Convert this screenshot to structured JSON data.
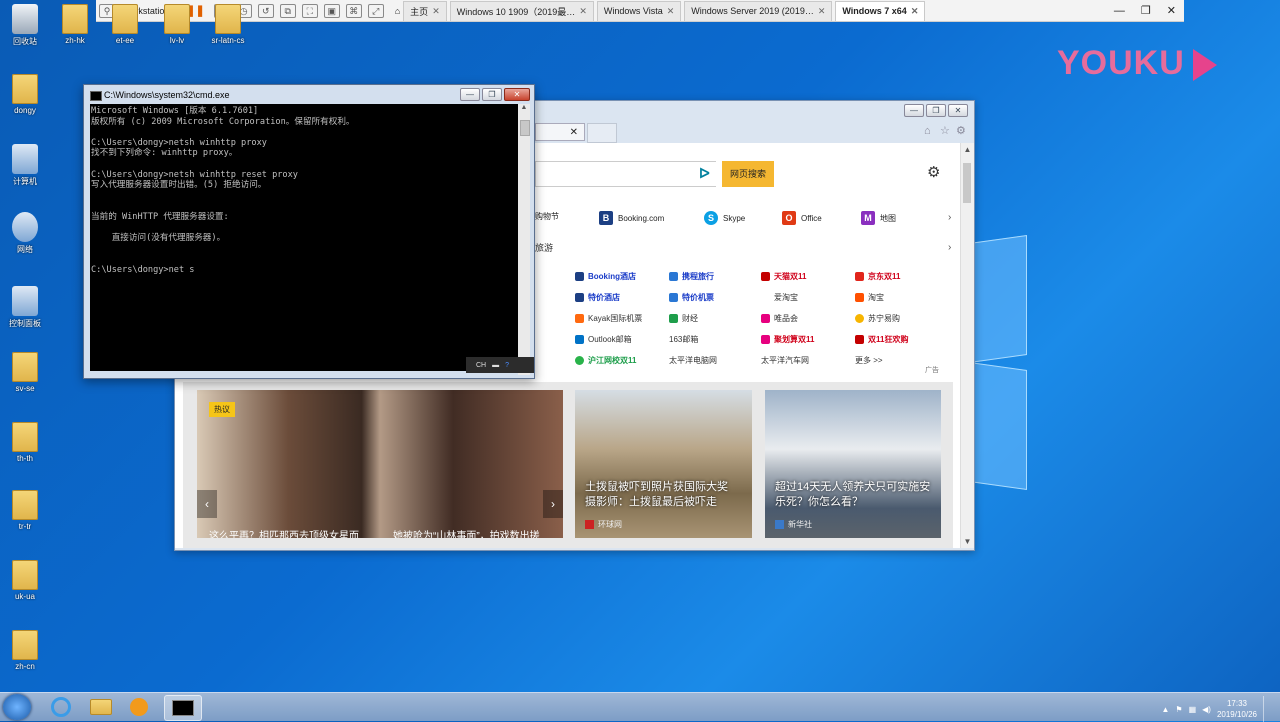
{
  "host_toolbar": {
    "workstation_label": "Workstation",
    "tabs": [
      {
        "label": "主页"
      },
      {
        "label": "Windows 10 1909（2019最…"
      },
      {
        "label": "Windows Vista"
      },
      {
        "label": "Windows Server 2019 (2019…"
      },
      {
        "label": "Windows 7 x64"
      }
    ]
  },
  "desktop_icons": [
    {
      "label": "回收站"
    },
    {
      "label": "zh-hk"
    },
    {
      "label": "et-ee"
    },
    {
      "label": "lv-lv"
    },
    {
      "label": "sr-latn-cs"
    },
    {
      "label": "dongy"
    },
    {
      "label": "计算机"
    },
    {
      "label": "网络"
    },
    {
      "label": "控制面板"
    },
    {
      "label": "sv-se"
    },
    {
      "label": "th-th"
    },
    {
      "label": "tr-tr"
    },
    {
      "label": "uk-ua"
    },
    {
      "label": "zh-cn"
    }
  ],
  "watermark": {
    "text": "YOUKU"
  },
  "cmd": {
    "title": "C:\\Windows\\system32\\cmd.exe",
    "lines": "Microsoft Windows [版本 6.1.7601]\n版权所有 (c) 2009 Microsoft Corporation。保留所有权利。\n\nC:\\Users\\dongy>netsh winhttp proxy\n找不到下列命令: winhttp proxy。\n\nC:\\Users\\dongy>netsh winhttp reset proxy\n写入代理服务器设置时出错。(5) 拒绝访问。\n\n\n当前的 WinHTTP 代理服务器设置:\n\n    直接访问(没有代理服务器)。\n\n\nC:\\Users\\dongy>net s",
    "ime_label": "CH"
  },
  "browser": {
    "search_button": "网页搜索",
    "quick_links": [
      {
        "label": "购物节"
      },
      {
        "label": "Booking.com",
        "icon": "B"
      },
      {
        "label": "Skype",
        "icon": "S"
      },
      {
        "label": "Office",
        "icon": "O"
      },
      {
        "label": "地图",
        "icon": "M"
      }
    ],
    "travel_label": "旅游",
    "links": [
      [
        "Booking酒店",
        "携程旅行",
        "天猫双11",
        "京东双11"
      ],
      [
        "特价酒店",
        "特价机票",
        "爱淘宝",
        "淘宝"
      ],
      [
        "Kayak国际机票",
        "财经",
        "唯品会",
        "苏宁易购"
      ],
      [
        "Outlook邮箱",
        "163邮箱",
        "聚划算双11",
        "双11狂欢购"
      ],
      [
        "沪江网校双11",
        "太平洋电脑网",
        "太平洋汽车网",
        "更多 >>"
      ]
    ],
    "ad_label": "广告",
    "hot_badge": "热议",
    "news": [
      {
        "caption": "土拨鼠被吓到照片获国际大奖 摄影师：土拨鼠最后被吓走",
        "source": "环球网"
      },
      {
        "caption": "超过14天无人领养犬只可实施安乐死？你怎么看？",
        "source": "新华社"
      }
    ],
    "bottom_captions": [
      "这么平再？相匹那西去顶级女星而",
      "她被呛为“山林事面”，拍戏数出搓"
    ]
  },
  "taskbar": {
    "time": "17:33",
    "date": "2019/10/26"
  }
}
